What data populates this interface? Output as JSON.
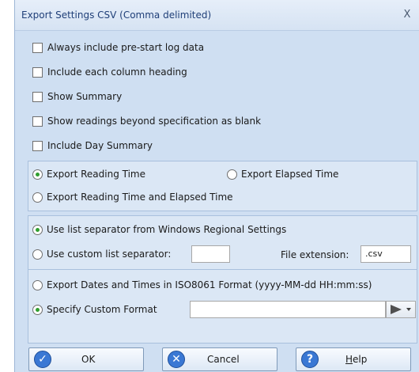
{
  "window": {
    "title": "Export Settings CSV (Comma delimited)",
    "close_glyph": "X"
  },
  "options": {
    "pre_start": {
      "label": "Always include pre-start log data",
      "checked": false
    },
    "column_heading": {
      "label": "Include each column heading",
      "checked": false
    },
    "show_summary": {
      "label": "Show Summary",
      "checked": false
    },
    "beyond_spec_blank": {
      "label": "Show readings beyond specification as blank",
      "checked": false
    },
    "day_summary": {
      "label": "Include Day Summary",
      "checked": false
    }
  },
  "time_export": {
    "reading_time": {
      "label": "Export Reading Time",
      "selected": true
    },
    "elapsed_time": {
      "label": "Export Elapsed Time",
      "selected": false
    },
    "both": {
      "label": "Export Reading Time and Elapsed Time",
      "selected": false
    }
  },
  "separator": {
    "windows_regional": {
      "label": "Use list separator from Windows Regional Settings",
      "selected": true
    },
    "custom": {
      "label": "Use custom list separator:",
      "selected": false,
      "value": ""
    },
    "file_extension_label": "File extension:",
    "file_extension_value": ".csv"
  },
  "date_format": {
    "iso8061": {
      "label": "Export Dates and Times in ISO8061 Format  (yyyy-MM-dd HH:mm:ss)",
      "selected": false
    },
    "custom": {
      "label": "Specify Custom Format",
      "selected": true,
      "value": ""
    }
  },
  "buttons": {
    "ok": {
      "label": "OK",
      "icon": "check-icon"
    },
    "cancel": {
      "label": "Cancel",
      "icon": "cancel-x-icon"
    },
    "help": {
      "label": "Help",
      "icon": "help-question-icon"
    }
  },
  "colors": {
    "dialog_bg": "#cfdff2",
    "title_text": "#1f3f78",
    "radio_selected": "#2f9e2f",
    "button_icon": "#3a78d4"
  }
}
